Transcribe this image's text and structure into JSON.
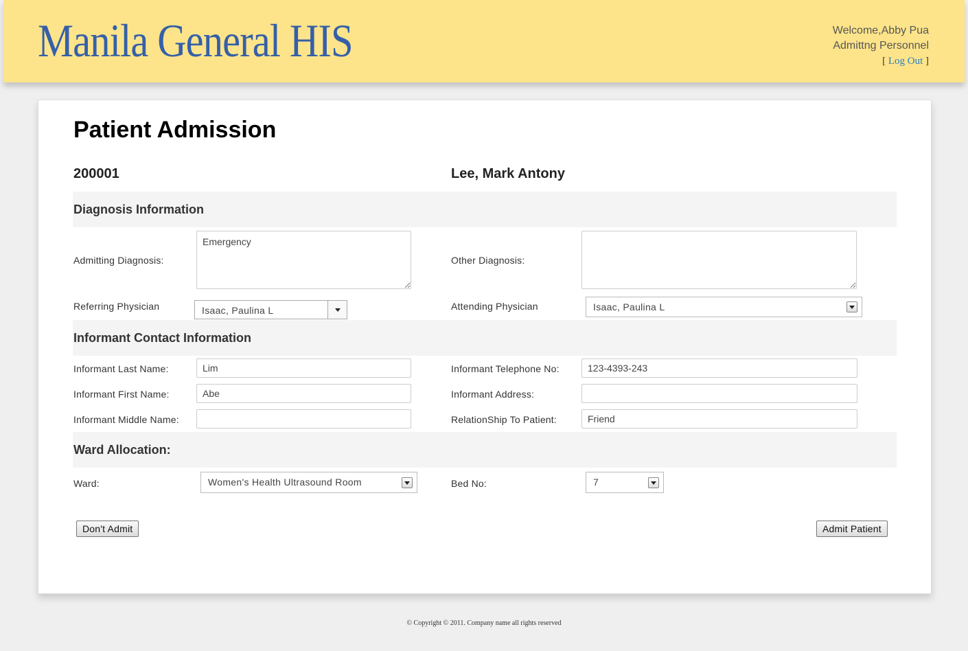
{
  "header": {
    "logo": "Manila General HIS",
    "welcome": "Welcome,Abby Pua",
    "role": "Admittng Personnel",
    "logout_open": "[",
    "logout_label": "Log Out",
    "logout_close": "]"
  },
  "page": {
    "title": "Patient Admission",
    "patient_id": "200001",
    "patient_name": "Lee, Mark Antony"
  },
  "diagnosis": {
    "section_title": "Diagnosis Information",
    "admitting_label": "Admitting Diagnosis:",
    "admitting_value": "Emergency",
    "other_label": "Other Diagnosis:",
    "other_value": "",
    "referring_label": "Referring Physician",
    "referring_value": "Isaac, Paulina L",
    "attending_label": "Attending Physician",
    "attending_value": "Isaac, Paulina L"
  },
  "informant": {
    "section_title": "Informant Contact Information",
    "last_name_label": "Informant Last Name:",
    "last_name_value": "Lim",
    "first_name_label": "Informant First Name:",
    "first_name_value": "Abe",
    "middle_name_label": "Informant Middle Name:",
    "middle_name_value": "",
    "telephone_label": "Informant Telephone No:",
    "telephone_value": "123-4393-243",
    "address_label": "Informant Address:",
    "address_value": "",
    "relationship_label": "RelationShip To Patient:",
    "relationship_value": "Friend"
  },
  "ward": {
    "section_title": "Ward Allocation:",
    "ward_label": "Ward:",
    "ward_value": "Women's Health Ultrasound Room",
    "bed_label": "Bed No:",
    "bed_value": "7"
  },
  "actions": {
    "dont_admit": "Don't Admit",
    "admit": "Admit Patient"
  },
  "footer": {
    "copyright": "© Copyright © 2011. Company name all rights reserved"
  }
}
